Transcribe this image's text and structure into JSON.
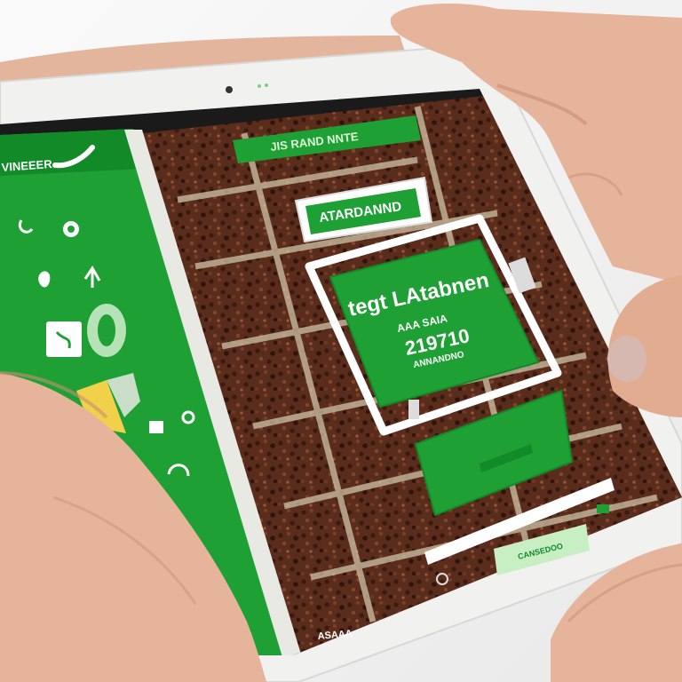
{
  "scene": {
    "subject": "hands holding a white tablet showing a green app over a soil field view",
    "colors": {
      "app_green": "#1fa035",
      "app_green_dark": "#138a28",
      "soil": "#5a2c1c",
      "soil_dark": "#3b1a10",
      "tablet_white": "#f1f1ef",
      "skin": "#e6b49a",
      "skin_shadow": "#c88d72"
    }
  },
  "sidebar": {
    "title": "VINEEER",
    "icons": [
      "curve-arrow-icon",
      "pin-icon",
      "leaf-icon",
      "plant-icon",
      "zero-badge-icon",
      "card-icon",
      "paper-icon",
      "small-square-icon",
      "small-circle-icon",
      "swirl-icon"
    ],
    "footer_label": "ASAAA"
  },
  "field_view": {
    "top_banner": "JIS RAND NNTE",
    "header_label": "ATARDANND",
    "info_card": {
      "line1": "tegt LAtabnen",
      "line2": "AAA SAIA",
      "line3": "219710",
      "line4": "ANNANDNO"
    },
    "bottom_label": "CANSEDOO"
  }
}
